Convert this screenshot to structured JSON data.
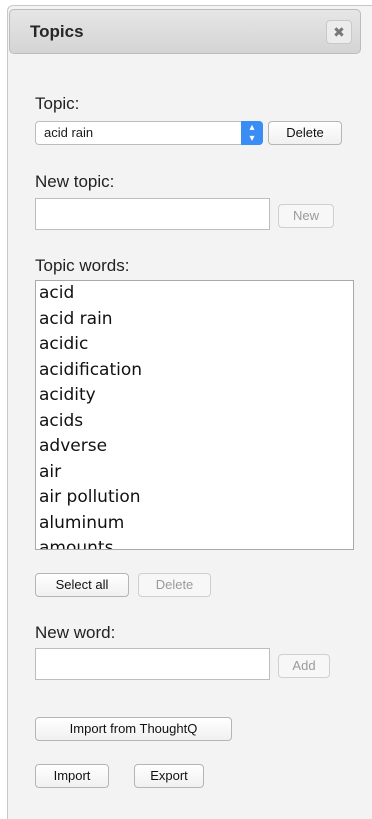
{
  "panel": {
    "title": "Topics",
    "close_glyph": "✖"
  },
  "topic": {
    "label": "Topic:",
    "selected": "acid rain",
    "delete_label": "Delete"
  },
  "new_topic": {
    "label": "New topic:",
    "value": "",
    "new_label": "New"
  },
  "topic_words": {
    "label": "Topic words:",
    "items": [
      "acid",
      "acid rain",
      "acidic",
      "acidification",
      "acidity",
      "acids",
      "adverse",
      "air",
      "air pollution",
      "aluminum",
      "amounts"
    ],
    "select_all_label": "Select all",
    "delete_label": "Delete"
  },
  "new_word": {
    "label": "New word:",
    "value": "",
    "add_label": "Add"
  },
  "actions": {
    "import_thoughtq_label": "Import from ThoughtQ",
    "import_label": "Import",
    "export_label": "Export"
  }
}
